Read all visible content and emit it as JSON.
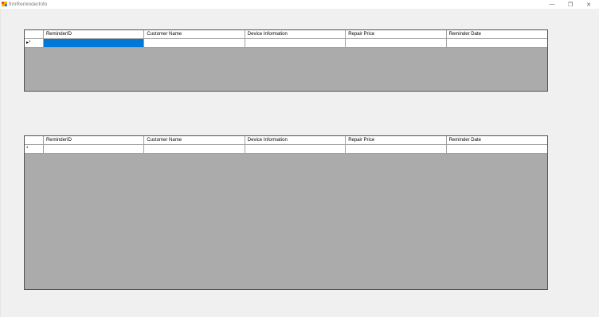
{
  "window": {
    "title": "frmReminderInfo",
    "minimize": "—",
    "restore": "❐",
    "close": "✕"
  },
  "grids": [
    {
      "columns": [
        "ReminderID",
        "Customer Name",
        "Device Information",
        "Repair Price",
        "Reminder Date"
      ],
      "new_row_indicator": "▸*",
      "rows": [
        [
          "",
          "",
          "",
          "",
          ""
        ]
      ],
      "selected_cell": "ReminderID"
    },
    {
      "columns": [
        "ReminderID",
        "Customer Name",
        "Device Information",
        "Repair Price",
        "Reminder Date"
      ],
      "new_row_indicator": "*",
      "rows": [
        [
          "",
          "",
          "",
          "",
          ""
        ]
      ]
    }
  ],
  "colors": {
    "grid_background": "#ababab",
    "selection": "#0078d7",
    "form_background": "#f0f0f0"
  }
}
